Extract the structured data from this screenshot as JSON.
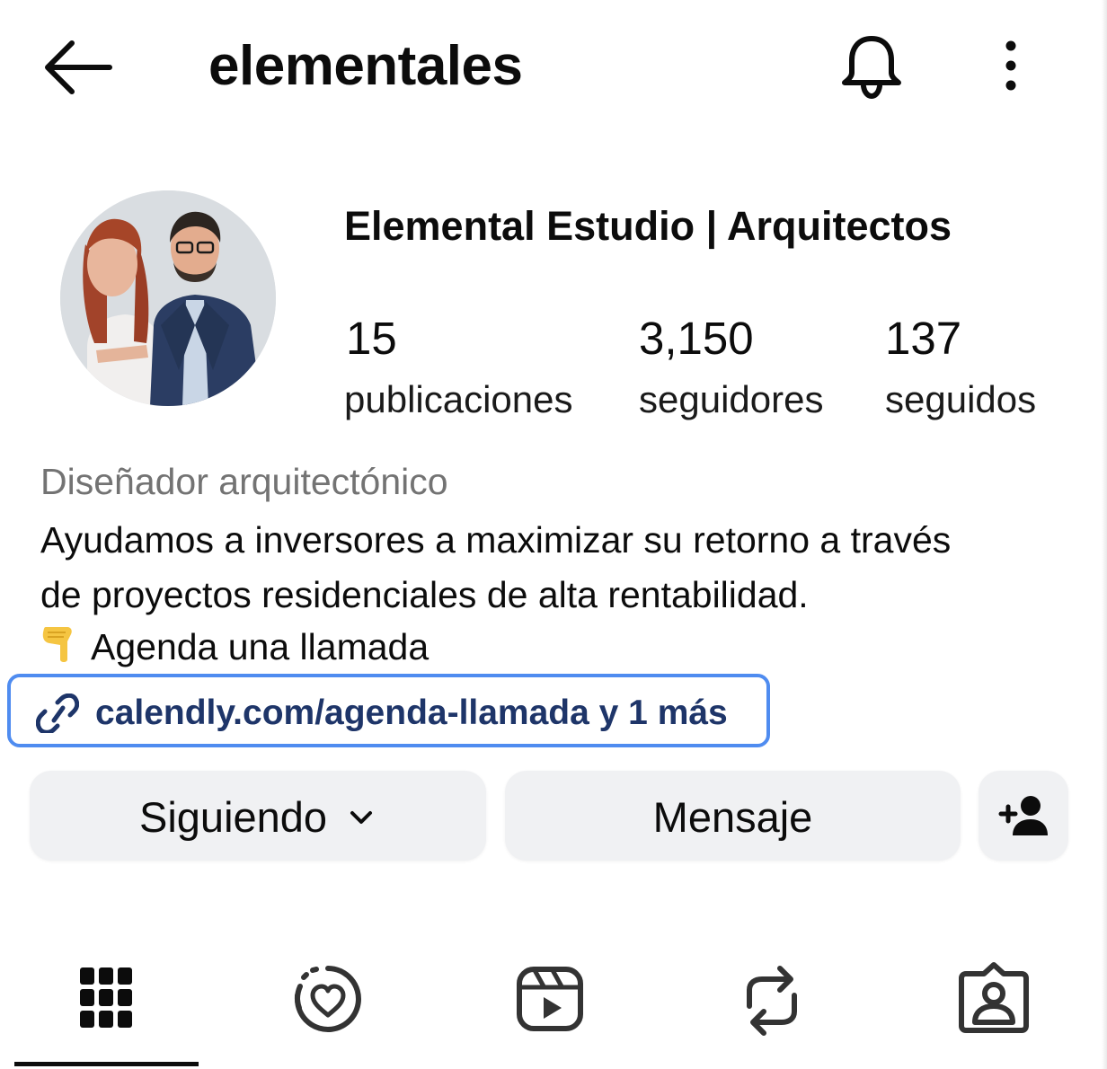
{
  "header": {
    "back_icon": "arrow-left-icon",
    "username": "elementales",
    "notifications_icon": "bell-icon",
    "more_icon": "more-vertical-icon"
  },
  "profile": {
    "avatar_icon": "profile-photo",
    "display_name": "Elemental Estudio | Arquitectos",
    "stats": {
      "posts": {
        "value": "15",
        "label": "publicaciones"
      },
      "followers": {
        "value": "3,150",
        "label": "seguidores"
      },
      "following": {
        "value": "137",
        "label": "seguidos"
      }
    },
    "category": "Diseñador arquitectónico",
    "bio_line1": "Ayudamos a inversores a maximizar su retorno a través",
    "bio_line2": "de proyectos residenciales de alta rentabilidad.",
    "cta_emoji": "pointing-down-hand-emoji",
    "cta_text": "Agenda una llamada",
    "link": {
      "icon": "link-icon",
      "text": "calendly.com/agenda-llamada y 1 más",
      "highlight_color": "#4f8cf0",
      "text_color": "#1e3569"
    }
  },
  "actions": {
    "follow_label": "Siguiendo",
    "follow_chevron_icon": "chevron-down-icon",
    "message_label": "Mensaje",
    "add_user_icon": "add-user-icon"
  },
  "tabs": [
    {
      "icon": "grid-icon",
      "active": true
    },
    {
      "icon": "highlights-heart-icon",
      "active": false
    },
    {
      "icon": "reels-icon",
      "active": false
    },
    {
      "icon": "reposts-icon",
      "active": false
    },
    {
      "icon": "tagged-icon",
      "active": false
    }
  ]
}
